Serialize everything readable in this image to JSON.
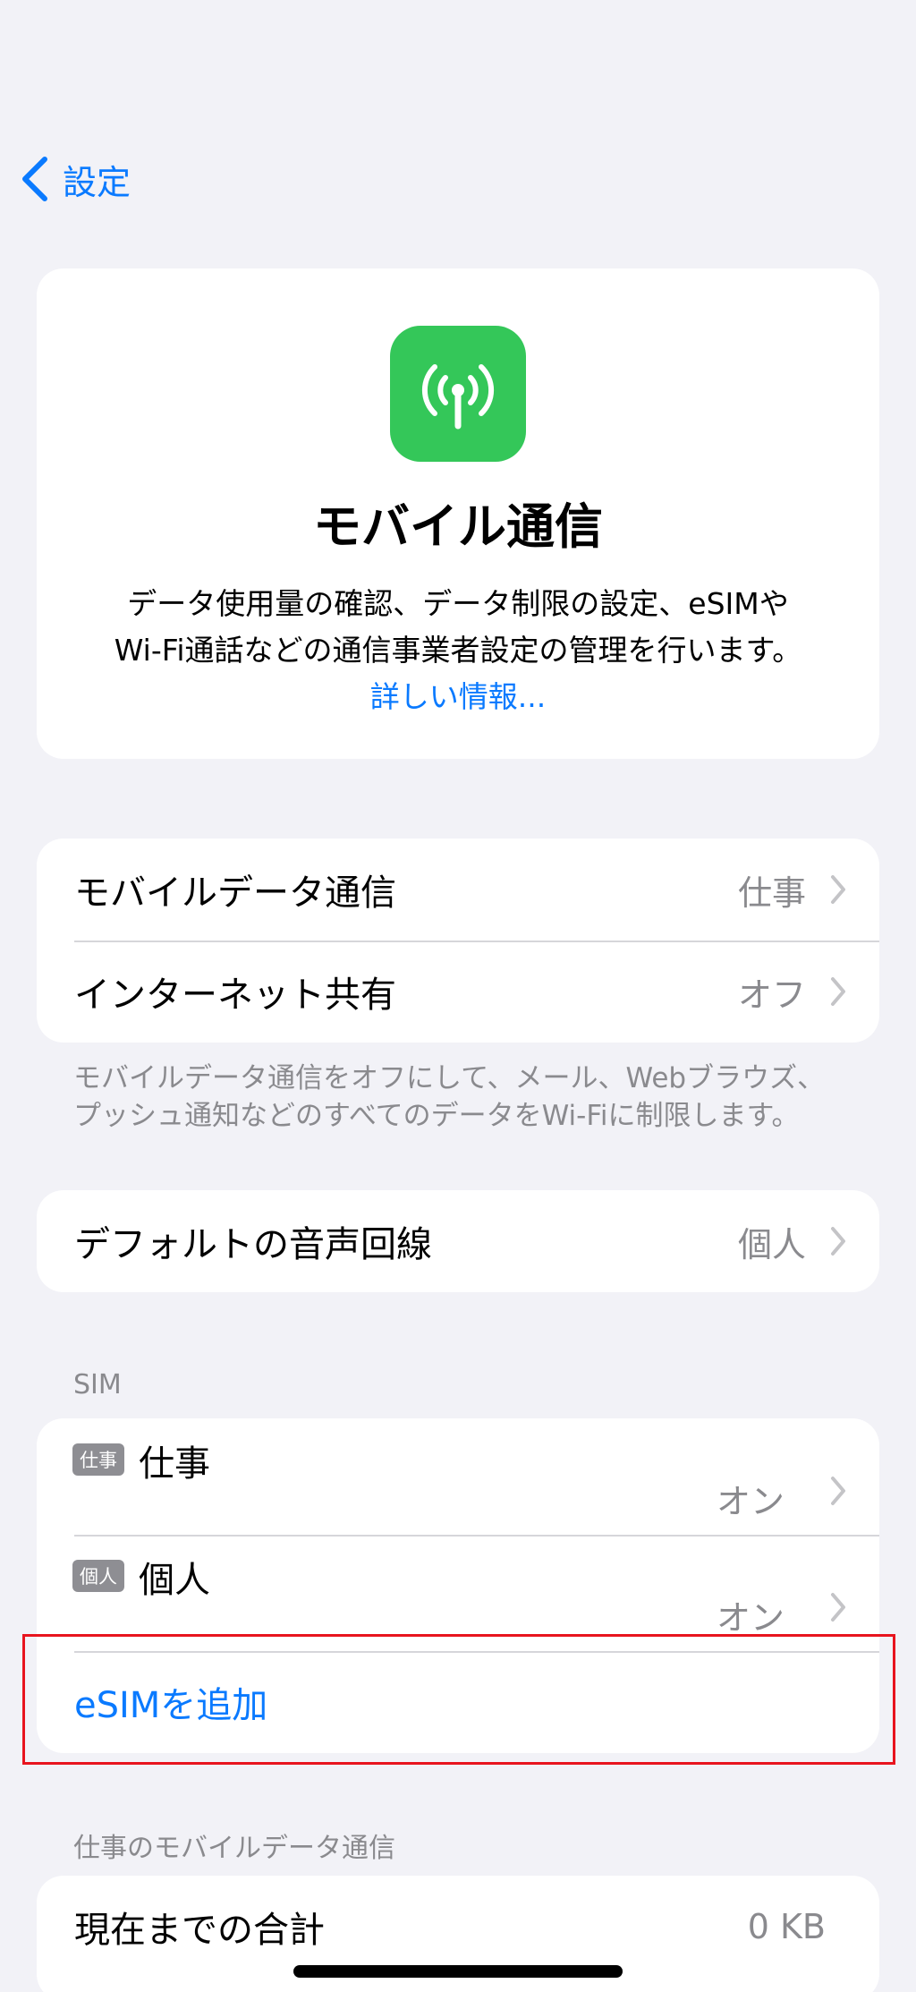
{
  "nav": {
    "back_label": "設定"
  },
  "hero": {
    "icon": "antenna-radiowaves-icon",
    "title": "モバイル通信",
    "description_line1": "データ使用量の確認、データ制限の設定、eSIMや",
    "description_line2": "Wi-Fi通話などの通信事業者設定の管理を行います。",
    "learn_more": "詳しい情報..."
  },
  "data_group": {
    "rows": [
      {
        "label": "モバイルデータ通信",
        "value": "仕事"
      },
      {
        "label": "インターネット共有",
        "value": "オフ"
      }
    ],
    "footnote_line1": "モバイルデータ通信をオフにして、メール、Webブラウズ、",
    "footnote_line2": "プッシュ通知などのすべてのデータをWi-Fiに制限します。"
  },
  "voice_group": {
    "rows": [
      {
        "label": "デフォルトの音声回線",
        "value": "個人"
      }
    ]
  },
  "sim_section": {
    "header": "SIM",
    "sims": [
      {
        "badge": "仕事",
        "name": "仕事",
        "status": "オン"
      },
      {
        "badge": "個人",
        "name": "個人",
        "status": "オン"
      }
    ],
    "add_esim": "eSIMを追加"
  },
  "usage_section": {
    "header": "仕事のモバイルデータ通信",
    "rows": [
      {
        "label": "現在までの合計",
        "value": "0 KB"
      }
    ]
  },
  "colors": {
    "accent": "#0a7aff",
    "icon_bg": "#34c759",
    "background": "#f2f2f7",
    "highlight": "#e8141e"
  }
}
